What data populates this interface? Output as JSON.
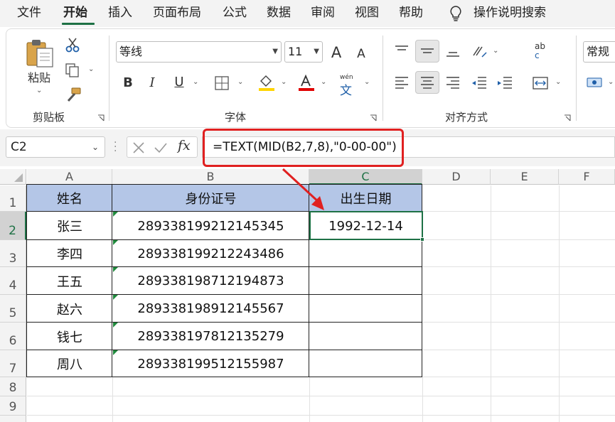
{
  "menu": {
    "tabs": [
      "文件",
      "开始",
      "插入",
      "页面布局",
      "公式",
      "数据",
      "审阅",
      "视图",
      "帮助"
    ],
    "active_tab": "开始",
    "search_label": "操作说明搜索"
  },
  "ribbon": {
    "clipboard": {
      "paste_label": "粘贴",
      "group_label": "剪贴板"
    },
    "font": {
      "font_name": "等线",
      "font_size": "11",
      "group_label": "字体",
      "phonetic_top": "wén",
      "phonetic_bottom": "文",
      "bold": "B",
      "italic": "I",
      "underline": "U",
      "grow": "A",
      "shrink": "A"
    },
    "alignment": {
      "group_label": "对齐方式",
      "wrap_top": "ab",
      "wrap_bottom": "c"
    },
    "number": {
      "format": "常规"
    }
  },
  "formula_bar": {
    "name_box": "C2",
    "fx": "fx",
    "formula": "=TEXT(MID(B2,7,8),\"0-00-00\")"
  },
  "sheet": {
    "columns": [
      "A",
      "B",
      "C",
      "D",
      "E",
      "F"
    ],
    "selected_column": "C",
    "rows": [
      "1",
      "2",
      "3",
      "4",
      "5",
      "6",
      "7",
      "8",
      "9"
    ],
    "selected_row": "2",
    "header": [
      "姓名",
      "身份证号",
      "出生日期"
    ],
    "data": [
      [
        "张三",
        "289338199212145345",
        "1992-12-14"
      ],
      [
        "李四",
        "289338199212243486",
        ""
      ],
      [
        "王五",
        "289338198712194873",
        ""
      ],
      [
        "赵六",
        "289338198912145567",
        ""
      ],
      [
        "钱七",
        "289338197812135279",
        ""
      ],
      [
        "周八",
        "289338199512155987",
        ""
      ]
    ]
  },
  "colors": {
    "accent_green": "#1e7145",
    "header_fill": "#b4c6e7",
    "annotation_red": "#e02020"
  }
}
